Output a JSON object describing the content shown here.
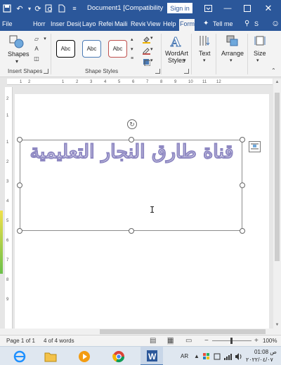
{
  "titlebar": {
    "doc_title": "Document1 [Compatibility ...",
    "signin_label": "Sign in"
  },
  "tabs": [
    {
      "label": "File"
    },
    {
      "label": "Horr"
    },
    {
      "label": "Inser"
    },
    {
      "label": "Desi("
    },
    {
      "label": "Layo"
    },
    {
      "label": "Refei"
    },
    {
      "label": "Maili"
    },
    {
      "label": "Revie"
    },
    {
      "label": "View"
    },
    {
      "label": "Help"
    },
    {
      "label": "Form",
      "active": true
    },
    {
      "label": "Tell me"
    },
    {
      "label": "S"
    }
  ],
  "ribbon": {
    "shapes_label": "Shapes",
    "insert_shapes_label": "Insert Shapes",
    "style_swatches": [
      "Abc",
      "Abc",
      "Abc"
    ],
    "shape_styles_label": "Shape Styles",
    "wordart_label_1": "WordArt",
    "wordart_label_2": "Styles",
    "text_label": "Text",
    "arrange_label": "Arrange",
    "size_label": "Size"
  },
  "ruler": {
    "h_marks": [
      "1",
      "2",
      "1",
      "2",
      "3",
      "4",
      "5",
      "6",
      "7",
      "8",
      "9",
      "10",
      "11",
      "12"
    ],
    "v_marks": [
      "2",
      "1",
      "1",
      "2",
      "3",
      "4",
      "5",
      "6",
      "7",
      "8",
      "9"
    ]
  },
  "document": {
    "wordart_text": "قناة طارق النجار التعليمية"
  },
  "statusbar": {
    "page_info": "Page 1 of 1",
    "word_count": "4 of 4 words",
    "zoom": "100%"
  },
  "taskbar": {
    "lang": "AR",
    "time": "01:08 ص",
    "date": "٢٠٢٢/٠٤/٠٧"
  },
  "colors": {
    "word_blue": "#2b579a",
    "wordart_outline": "#8e88c2",
    "style1_border": "#000000",
    "style2_border": "#4a7ab5",
    "style3_border": "#c0504d"
  }
}
